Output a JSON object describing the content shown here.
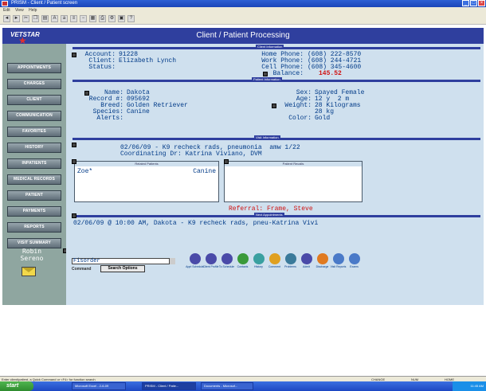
{
  "window": {
    "title": "PRISM - Client / Patient screen"
  },
  "menu": [
    "Edit",
    "View",
    "Help"
  ],
  "header": {
    "logo": "VETSTAR",
    "title": "Client / Patient Processing"
  },
  "sidebar": {
    "items": [
      "APPOINTMENTS",
      "CHARGES",
      "CLIENT",
      "COMMUNICATION",
      "FAVORITES",
      "HISTORY",
      "INPATIENTS",
      "MEDICAL RECORDS",
      "PATIENT",
      "PAYMENTS",
      "REPORTS",
      "VISIT SUMMARY"
    ],
    "user_first": "Robin",
    "user_last": "Sereno"
  },
  "client": {
    "section": "Client Information",
    "account_label": "Account:",
    "account": "91228",
    "client_label": "Client:",
    "client": "Elizabeth Lynch",
    "status_label": "Status:",
    "home_label": "Home Phone:",
    "home": "(608) 222-8570",
    "work_label": "Work Phone:",
    "work": "(608) 244-4721",
    "cell_label": "Cell Phone:",
    "cell": "(608) 345-4600",
    "balance_label": "Balance:",
    "balance": "145.52"
  },
  "patient": {
    "section": "Patient Information",
    "name_label": "Name:",
    "name": "Dakota",
    "record_label": "Record #:",
    "record": "095692",
    "breed_label": "Breed:",
    "breed": "Golden Retriever",
    "species_label": "Species:",
    "species": "Canine",
    "alerts_label": "Alerts:",
    "sex_label": "Sex:",
    "sex": "Spayed Female",
    "age_label": "Age:",
    "age": "12 y  2 m",
    "weight_label": "Weight:",
    "weight": "28 Kilograms",
    "weight2": "28 kg",
    "color_label": "Color:",
    "color": "Gold"
  },
  "visit": {
    "section": "Visit Information",
    "line1": "02/06/09 - K9 recheck rads, pneumonia  amw 1/22",
    "line2": "Coordinating Dr: Katrina Viviano, DVM"
  },
  "related": {
    "title": "Related Patients",
    "name": "Zoe*",
    "species": "Canine"
  },
  "recalls": {
    "title": "Patient Recalls"
  },
  "referral": "Referral: Frame, Steve",
  "appointments": {
    "section": "Next Appointments",
    "line": "02/06/09 @ 10:00 AM, Dakota - K9 recheck rads, pneu-Katrina Vivi"
  },
  "command": {
    "value": "Fisorder",
    "label": "Command",
    "search": "Search Options"
  },
  "actions": [
    {
      "label": "Appt Schedule",
      "color": "#4a4aa8"
    },
    {
      "label": "Client Profile",
      "color": "#4a4aa8"
    },
    {
      "label": "To Schedule",
      "color": "#4a4aa8"
    },
    {
      "label": "Contacts",
      "color": "#3a9a3a"
    },
    {
      "label": "History",
      "color": "#3aa0a0"
    },
    {
      "label": "Comment",
      "color": "#e0a020"
    },
    {
      "label": "Problems",
      "color": "#3a7a9a"
    },
    {
      "label": "Admit",
      "color": "#4a4aa8"
    },
    {
      "label": "Discharge",
      "color": "#e07a20"
    },
    {
      "label": "Visit Reports",
      "color": "#4a7ac8"
    },
    {
      "label": "Exams",
      "color": "#4a7ac8"
    }
  ],
  "statusbar": {
    "hint": "Enter client/patient, a Quick Command or <F4> for function search",
    "mode": "CHANGE",
    "num": "NUM",
    "home": "HOME"
  },
  "taskbar": {
    "start": "start",
    "tasks": [
      "Microsoft Excel - 2-6-09",
      "PRISM - Client / Patie...",
      "Documents - Microsof..."
    ],
    "clock": "11:45 AM"
  }
}
